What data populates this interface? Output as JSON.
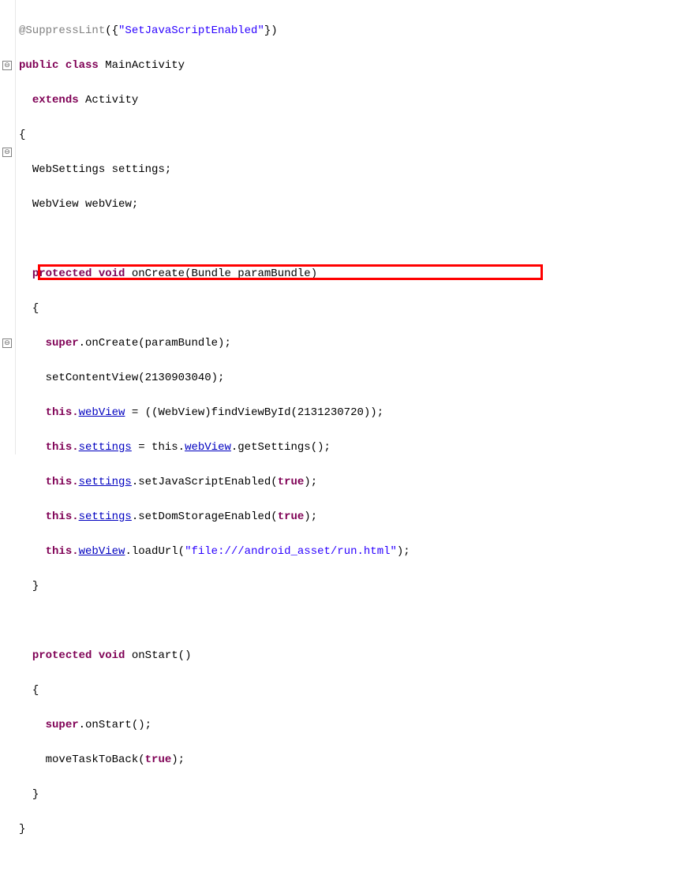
{
  "annotation": {
    "at": "@SuppressLint",
    "paren_open": "({",
    "value": "\"SetJavaScriptEnabled\"",
    "paren_close": "})"
  },
  "class_decl": {
    "kw_public": "public",
    "kw_class": "class",
    "name": "MainActivity"
  },
  "extends": {
    "kw": "extends",
    "name": "Activity"
  },
  "brace_open": "{",
  "brace_close": "}",
  "field1": {
    "type": "WebSettings",
    "name": "settings",
    "semi": ";"
  },
  "field2": {
    "type": "WebView",
    "name": "webView",
    "semi": ";"
  },
  "onCreate": {
    "kw_protected": "protected",
    "kw_void": "void",
    "name": "onCreate",
    "params": "(Bundle paramBundle)",
    "line1": {
      "kw_super": "super",
      "rest": ".onCreate(paramBundle);"
    },
    "line2": "setContentView(2130903040);",
    "line3": {
      "pre": "this.",
      "field": "webView",
      "post": " = ((WebView)findViewById(2131230720));"
    },
    "line4": {
      "pre": "this.",
      "field1": "settings",
      "mid": " = this.",
      "field2": "webView",
      "post": ".getSettings();"
    },
    "line5": {
      "pre": "this.",
      "field": "settings",
      "mid": ".setJavaScriptEnabled(",
      "lit": "true",
      "post": ");"
    },
    "line6": {
      "pre": "this.",
      "field": "settings",
      "mid": ".setDomStorageEnabled(",
      "lit": "true",
      "post": ");"
    },
    "line7": {
      "pre": "this.",
      "field": "webView",
      "mid": ".loadUrl(",
      "str": "\"file:///android_asset/run.html\"",
      "post": ");"
    }
  },
  "onStart": {
    "kw_protected": "protected",
    "kw_void": "void",
    "name": "onStart",
    "params": "()",
    "line1": {
      "kw_super": "super",
      "rest": ".onStart();"
    },
    "line2": {
      "pre": "moveTaskToBack(",
      "lit": "true",
      "post": ");"
    }
  },
  "fold_glyph": "⊖"
}
